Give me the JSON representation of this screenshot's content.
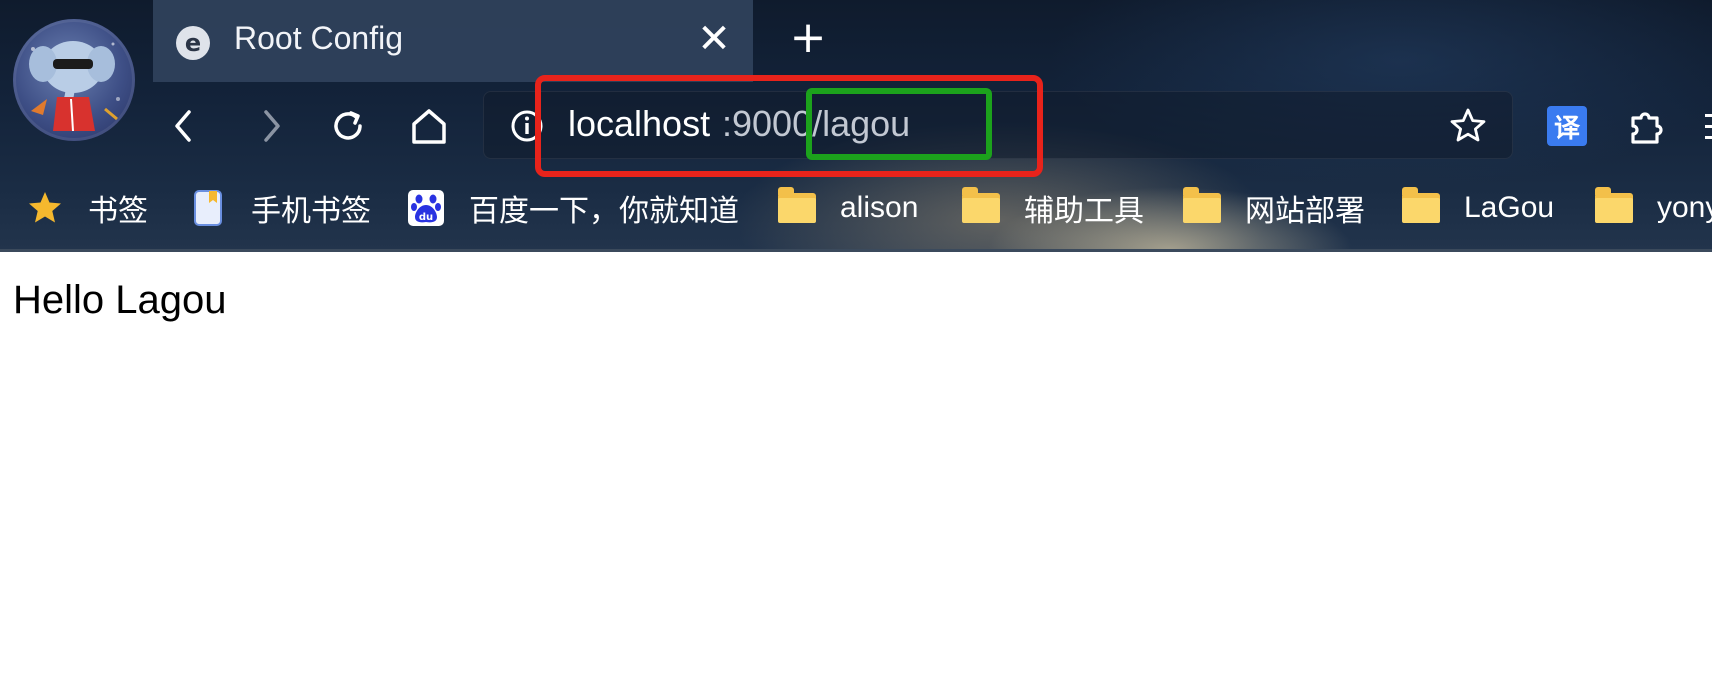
{
  "tab": {
    "title": "Root Config",
    "favicon": "e",
    "close_glyph": "✕",
    "new_tab_glyph": "+"
  },
  "toolbar": {
    "back_icon": "chevron-left-icon",
    "forward_icon": "chevron-right-icon",
    "reload_icon": "reload-icon",
    "home_icon": "home-icon"
  },
  "address_bar": {
    "host": "localhost",
    "rest": ":9000/lagou"
  },
  "extensions": {
    "translate_label": "译"
  },
  "bookmarks": [
    {
      "label": "书签",
      "icon": "star-icon"
    },
    {
      "label": "手机书签",
      "icon": "phone-bookmark-icon"
    },
    {
      "label": "百度一下，你就知道",
      "icon": "baidu-icon"
    },
    {
      "label": "alison",
      "icon": "folder-icon"
    },
    {
      "label": "辅助工具",
      "icon": "folder-icon"
    },
    {
      "label": "网站部署",
      "icon": "folder-icon"
    },
    {
      "label": "LaGou",
      "icon": "folder-icon"
    },
    {
      "label": "yony",
      "icon": "folder-icon"
    }
  ],
  "page": {
    "content": "Hello Lagou"
  },
  "colors": {
    "annotation_red": "#e8231b",
    "annotation_green": "#1ca21c",
    "translate_blue": "#3a7bf0",
    "folder_yellow": "#f3c04a"
  }
}
